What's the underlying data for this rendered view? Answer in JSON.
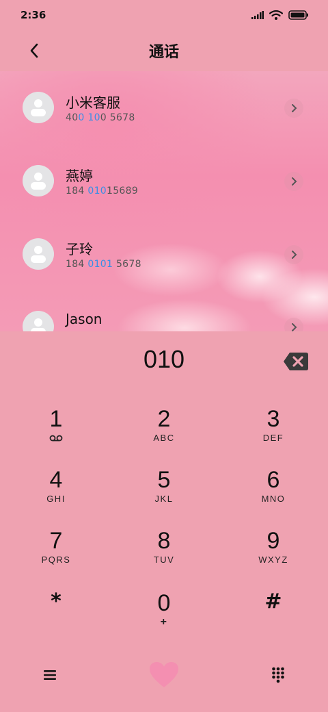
{
  "status_bar": {
    "time": "2:36",
    "icons": [
      "signal-icon",
      "wifi-icon",
      "battery-icon"
    ]
  },
  "header": {
    "title": "通话",
    "back_icon": "chevron-left-icon"
  },
  "contacts": [
    {
      "name": "小米客服",
      "number_parts": [
        "40",
        "0 10",
        "0 5678"
      ],
      "highlight_index": 1
    },
    {
      "name": "燕婷",
      "number_parts": [
        "184 ",
        "010",
        "15689"
      ],
      "highlight_index": 1
    },
    {
      "name": "子玲",
      "number_parts": [
        "184 ",
        "0101",
        " 5678"
      ],
      "highlight_index": 1
    },
    {
      "name": "Jason",
      "number_parts": [
        "",
        "",
        ""
      ],
      "highlight_index": 1
    }
  ],
  "dialer": {
    "input": "010",
    "backspace_icon": "backspace-icon",
    "keys": [
      {
        "digit": "1",
        "letters": "",
        "icon": "voicemail-icon"
      },
      {
        "digit": "2",
        "letters": "ABC"
      },
      {
        "digit": "3",
        "letters": "DEF"
      },
      {
        "digit": "4",
        "letters": "GHI"
      },
      {
        "digit": "5",
        "letters": "JKL"
      },
      {
        "digit": "6",
        "letters": "MNO"
      },
      {
        "digit": "7",
        "letters": "PQRS"
      },
      {
        "digit": "8",
        "letters": "TUV"
      },
      {
        "digit": "9",
        "letters": "WXYZ"
      },
      {
        "digit": "*",
        "letters": ""
      },
      {
        "digit": "0",
        "letters": "+"
      },
      {
        "digit": "#",
        "letters": ""
      }
    ]
  },
  "bottom_bar": {
    "left_icon": "menu-icon",
    "center_icon": "heart-call-icon",
    "right_icon": "keypad-icon"
  },
  "colors": {
    "background": "#efa2b1",
    "highlight": "#3a8ee6",
    "heart": "#f48fb1"
  }
}
